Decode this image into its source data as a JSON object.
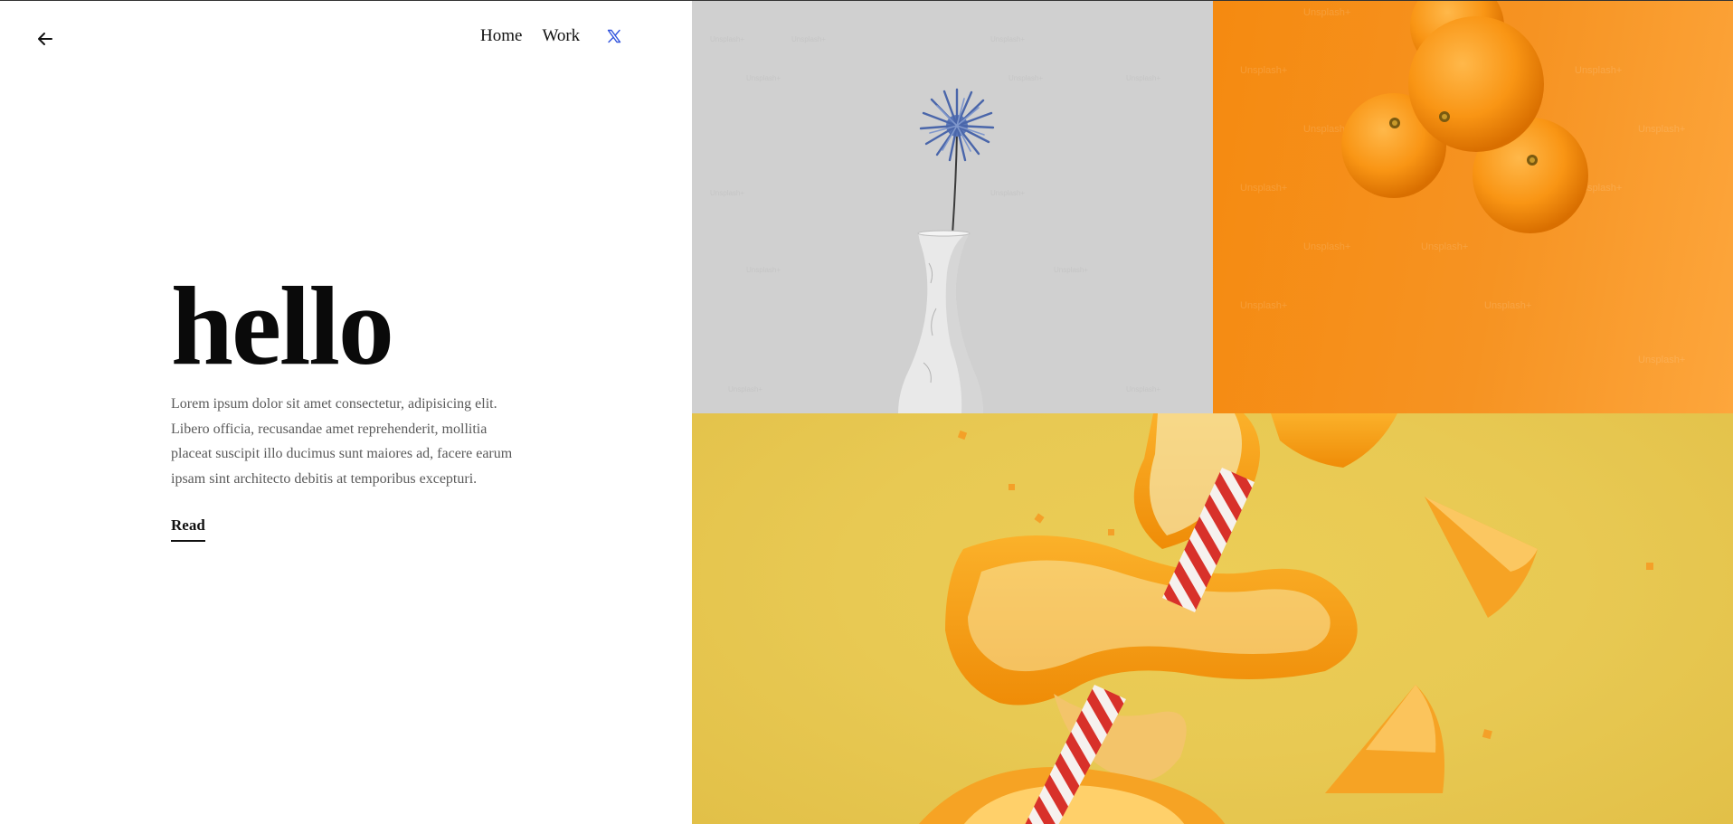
{
  "nav": {
    "back_icon": "arrow-left-icon",
    "links": [
      {
        "label": "Home"
      },
      {
        "label": "Work"
      }
    ],
    "social_icon": "x-logo-icon",
    "social_color": "#3355dd"
  },
  "hero": {
    "title": "hello",
    "body": "Lorem ipsum dolor sit amet consectetur, adipisicing elit. Libero officia, recusandae amet reprehenderit, mollitia placeat suscipit illo ducimus sunt maiores ad, facere earum ipsam sint architecto debitis at temporibus excepturi.",
    "read_label": "Read"
  },
  "gallery": {
    "images": [
      {
        "name": "blue-flower-in-white-vase",
        "background": "#d0d0d0"
      },
      {
        "name": "three-tangerines",
        "background": "#f58a10"
      },
      {
        "name": "orange-peel-with-straw",
        "background": "#e8c953"
      }
    ],
    "watermark": "Unsplash+"
  }
}
